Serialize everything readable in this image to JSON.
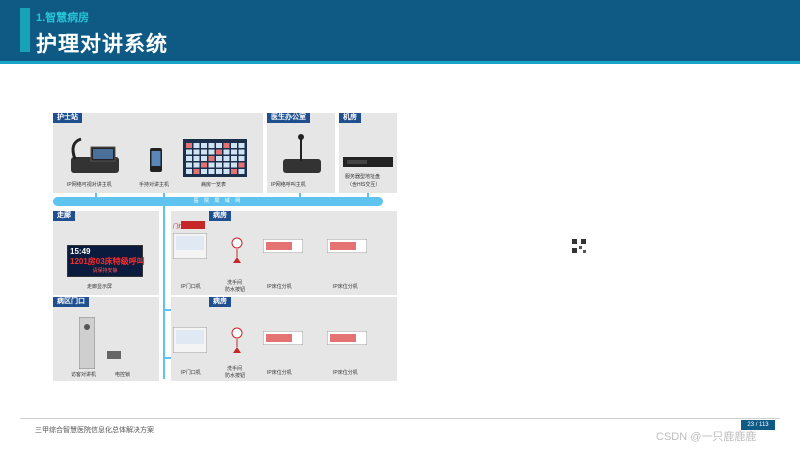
{
  "header": {
    "section": "1.智慧病房",
    "title": "护理对讲系统"
  },
  "panels": {
    "nurse_station": "护士站",
    "doctor_office": "医生办公室",
    "machine_room": "机房",
    "corridor": "走廊",
    "ward1": "病房",
    "ward2": "病房",
    "entrance": "病区门口"
  },
  "devices": {
    "nurse_host": "IP网络可视对讲主机",
    "handheld": "手持对讲主机",
    "ward_board": "病房一览表",
    "doctor_host": "IP网络呼叫主机",
    "server": "服务器型地址盘",
    "server_sub": "（含HIS交互）",
    "corridor_screen": "走廊显示屏",
    "door_unit1": "IP门口机",
    "door_unit2": "IP门口机",
    "bath_btn1_line1": "洗手间",
    "bath_btn1_line2": "防水按钮",
    "bath_btn2_line1": "洗手间",
    "bath_btn2_line2": "防水按钮",
    "bed1a": "IP床位分机",
    "bed1b": "IP床位分机",
    "bed2a": "IP床位分机",
    "bed2b": "IP床位分机",
    "intercom": "访客对讲机",
    "lock": "电控锁",
    "door_light": "门灯"
  },
  "network": "医 院 局 域 网",
  "screen_display": {
    "time": "15:49",
    "message": "1201房03床特级呼叫",
    "sub": "请保持安静"
  },
  "footer": {
    "text": "三甲综合智慧医院信息化总体解决方案",
    "page": "23 / 113",
    "watermark": "CSDN @一只鹿鹿鹿"
  },
  "colors": {
    "header": "#0e5a85",
    "accent": "#17a2b8",
    "network": "#5fc3ef",
    "tag": "#1f4f8f"
  }
}
